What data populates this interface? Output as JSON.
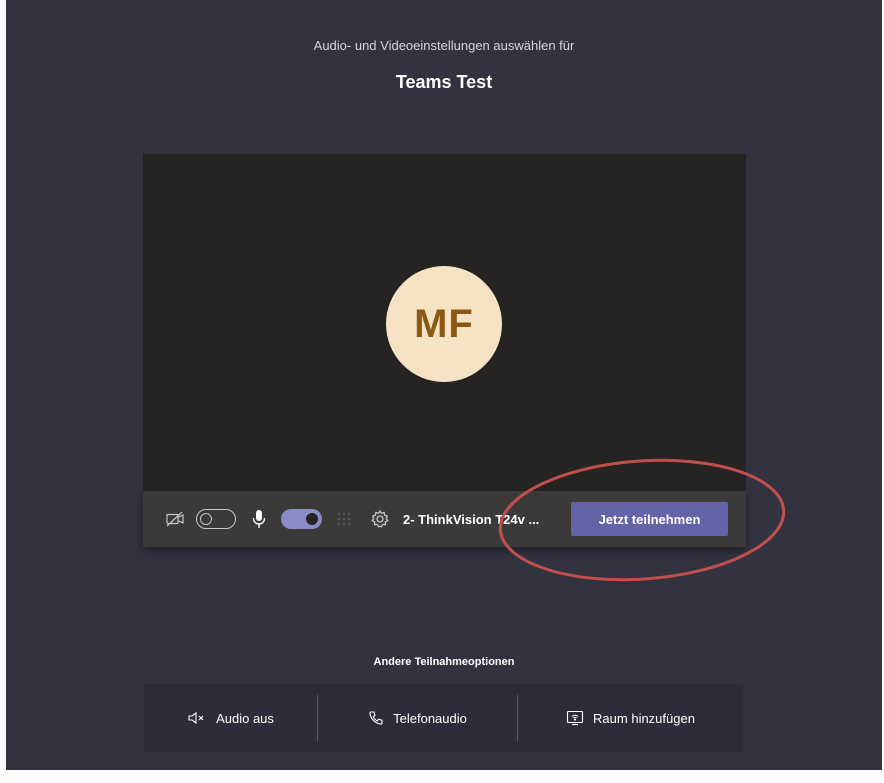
{
  "header": {
    "subtitle": "Audio- und Videoeinstellungen auswählen für",
    "meeting_title": "Teams Test"
  },
  "preview": {
    "avatar_initials": "MF"
  },
  "controls": {
    "camera_icon": "camera-off-icon",
    "camera_enabled": false,
    "mic_icon": "microphone-icon",
    "mic_enabled": true,
    "blur_icon": "background-blur-icon",
    "settings_icon": "gear-icon",
    "device_label": "2- ThinkVision T24v ...",
    "join_button": "Jetzt teilnehmen"
  },
  "other_options": {
    "title": "Andere Teilnahmeoptionen",
    "items": [
      {
        "icon": "speaker-muted-icon",
        "label": "Audio aus"
      },
      {
        "icon": "phone-icon",
        "label": "Telefonaudio"
      },
      {
        "icon": "room-cast-icon",
        "label": "Raum hinzufügen"
      }
    ]
  },
  "colors": {
    "background": "#33323f",
    "preview": "#252423",
    "accent": "#6264a7",
    "toggle_on": "#8b8cc7",
    "avatar_bg": "#f5e3c4",
    "avatar_fg": "#8b5a12",
    "annotation": "#c0504d"
  }
}
